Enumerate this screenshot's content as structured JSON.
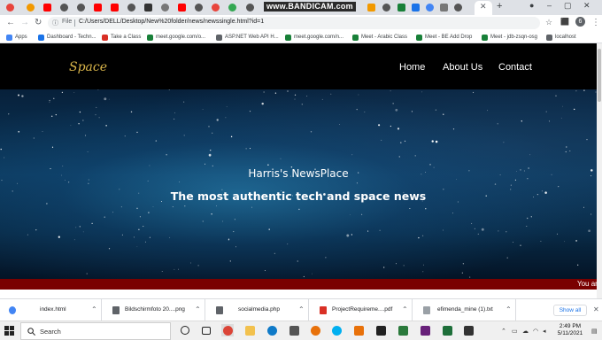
{
  "browser": {
    "bandicam_watermark": "www.BANDICAM.com",
    "new_tab": "+",
    "address": {
      "scheme_label": "File",
      "url": "C:/Users/DELL/Desktop/New%20folder/news/newssingle.html?id=1"
    },
    "bookmarks": [
      {
        "label": "Apps",
        "color": "#4285f4"
      },
      {
        "label": "Dashboard - Techn...",
        "color": "#1a73e8"
      },
      {
        "label": "Take a Class",
        "color": "#d93025"
      },
      {
        "label": "meet.google.com/o...",
        "color": "#188038"
      },
      {
        "label": "ASP.NET Web API H...",
        "color": "#5f6368"
      },
      {
        "label": "meet.google.com/n...",
        "color": "#188038"
      },
      {
        "label": "Meet - Arabic Class",
        "color": "#188038"
      },
      {
        "label": "Meet - BE Add Drop",
        "color": "#188038"
      },
      {
        "label": "Meet - jdb-zsqn-osg",
        "color": "#188038"
      },
      {
        "label": "localhost",
        "color": "#5f6368"
      }
    ]
  },
  "site": {
    "logo": "Space",
    "nav": {
      "home": "Home",
      "about": "About Us",
      "contact": "Contact"
    },
    "hero": {
      "title": "Harris's NewsPlace",
      "subtitle": "The most authentic tech and space news"
    },
    "ticker": "You are"
  },
  "downloads": {
    "items": [
      {
        "name": "index.html",
        "color": "#4285f4"
      },
      {
        "name": "Bildschirmfoto 20....png",
        "color": "#5f6368"
      },
      {
        "name": "socialmedia.php",
        "color": "#5f6368"
      },
      {
        "name": "ProjectRequireme....pdf",
        "color": "#d93025"
      },
      {
        "name": "efimenda_mine (1).txt",
        "color": "#5f6368"
      }
    ],
    "show_all": "Show all"
  },
  "taskbar": {
    "search_placeholder": "Search",
    "time": "2:49 PM",
    "date": "5/11/2021"
  }
}
